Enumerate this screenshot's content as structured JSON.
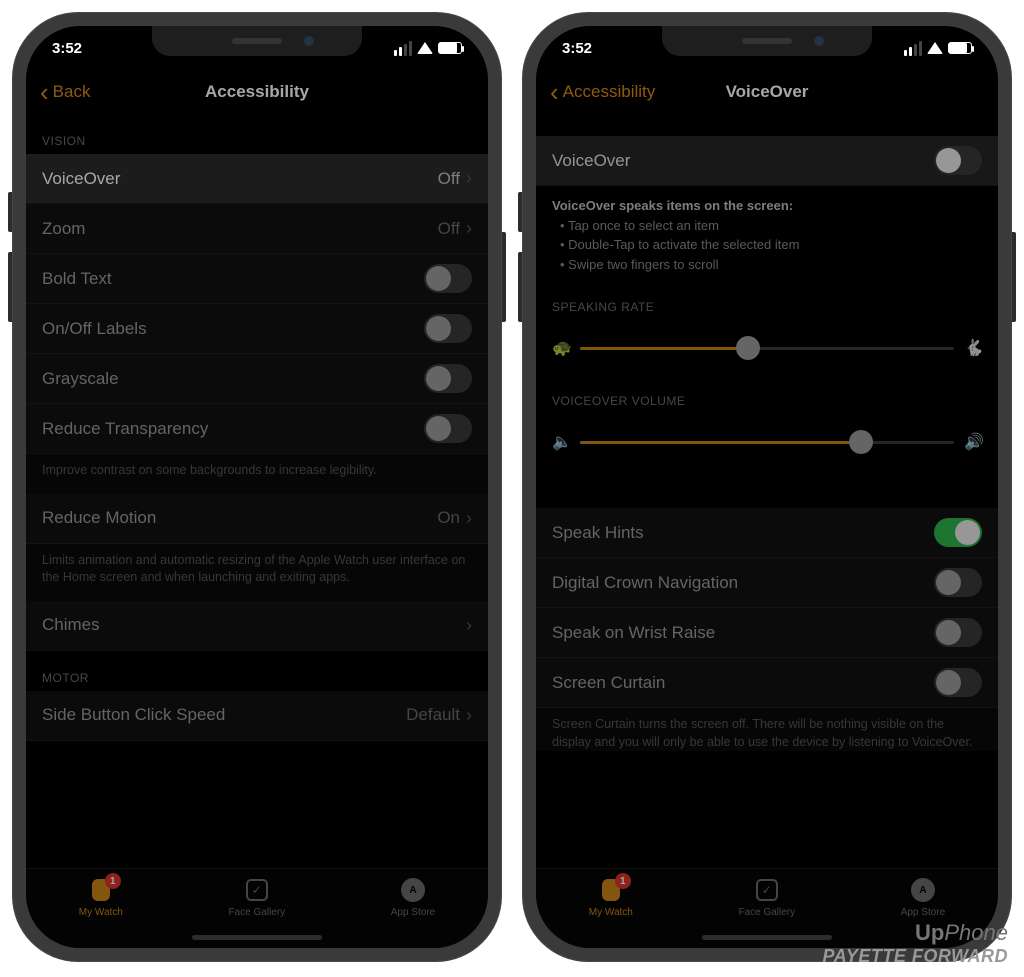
{
  "status": {
    "time": "3:52"
  },
  "tabs": {
    "my_watch": "My Watch",
    "face_gallery": "Face Gallery",
    "app_store": "App Store",
    "badge": "1"
  },
  "left": {
    "nav": {
      "back": "Back",
      "title": "Accessibility"
    },
    "sections": {
      "vision_label": "VISION",
      "motor_label": "MOTOR"
    },
    "rows": {
      "voiceover": {
        "label": "VoiceOver",
        "value": "Off"
      },
      "zoom": {
        "label": "Zoom",
        "value": "Off"
      },
      "bold_text": {
        "label": "Bold Text"
      },
      "onoff_labels": {
        "label": "On/Off Labels"
      },
      "grayscale": {
        "label": "Grayscale"
      },
      "reduce_transparency": {
        "label": "Reduce Transparency"
      },
      "reduce_motion": {
        "label": "Reduce Motion",
        "value": "On"
      },
      "chimes": {
        "label": "Chimes"
      },
      "side_button": {
        "label": "Side Button Click Speed",
        "value": "Default"
      }
    },
    "notes": {
      "transparency": "Improve contrast on some backgrounds to increase legibility.",
      "motion": "Limits animation and automatic resizing of the Apple Watch user interface on the Home screen and when launching and exiting apps."
    }
  },
  "right": {
    "nav": {
      "back": "Accessibility",
      "title": "VoiceOver"
    },
    "rows": {
      "voiceover": {
        "label": "VoiceOver"
      },
      "speak_hints": {
        "label": "Speak Hints"
      },
      "digital_crown": {
        "label": "Digital Crown Navigation"
      },
      "wrist_raise": {
        "label": "Speak on Wrist Raise"
      },
      "screen_curtain": {
        "label": "Screen Curtain"
      }
    },
    "help": {
      "title": "VoiceOver speaks items on the screen:",
      "b1": "Tap once to select an item",
      "b2": "Double-Tap to activate the selected item",
      "b3": "Swipe two fingers to scroll"
    },
    "sections": {
      "speaking_rate": "SPEAKING RATE",
      "volume": "VOICEOVER VOLUME"
    },
    "sliders": {
      "rate_pct": 45,
      "volume_pct": 75
    },
    "notes": {
      "curtain": "Screen Curtain turns the screen off. There will be nothing visible on the display and you will only be able to use the device by listening to VoiceOver."
    }
  },
  "watermark": {
    "line1a": "Up",
    "line1b": "Phone",
    "line2": "PAYETTE FORWARD"
  }
}
